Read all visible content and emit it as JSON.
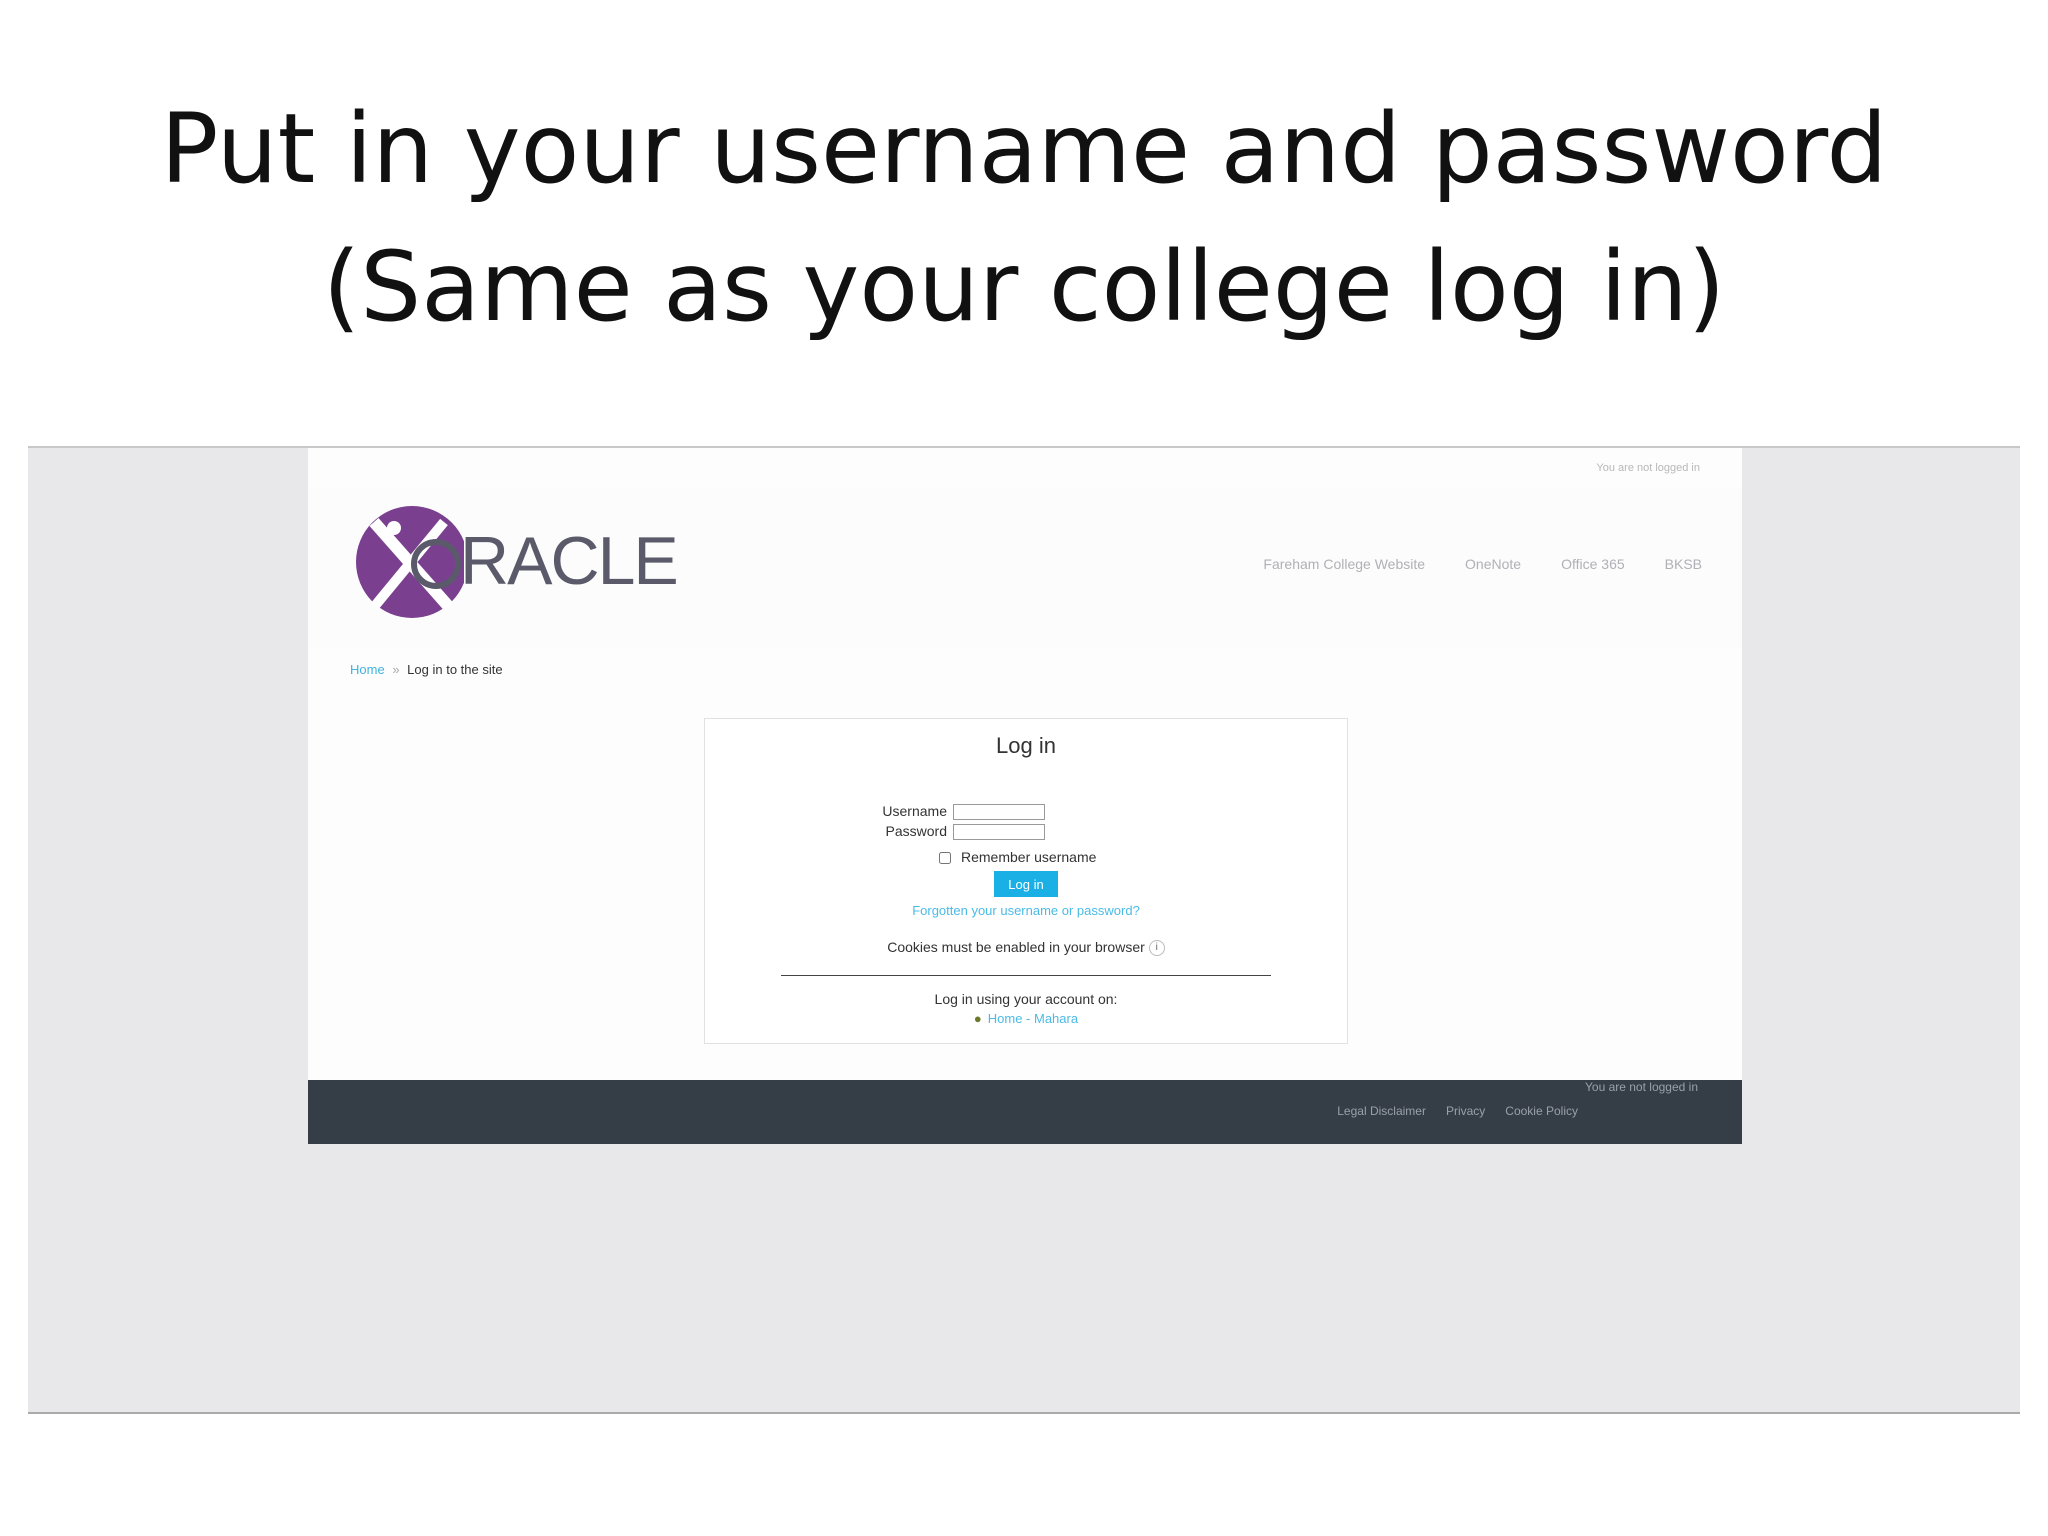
{
  "slide": {
    "title_line1": "Put in your username and password",
    "title_line2": "(Same as your college log in)"
  },
  "site": {
    "not_logged_in_top": "You are not logged in",
    "logo_text": "RACLE",
    "nav": [
      "Fareham College Website",
      "OneNote",
      "Office 365",
      "BKSB"
    ],
    "breadcrumb": {
      "home": "Home",
      "separator": "»",
      "current": "Log in to the site"
    }
  },
  "login": {
    "title": "Log in",
    "username_label": "Username",
    "username_value": "",
    "password_label": "Password",
    "password_value": "",
    "remember_label": "Remember username",
    "remember_checked": false,
    "button_label": "Log in",
    "forgot_link": "Forgotten your username or password?",
    "cookies_text": "Cookies must be enabled in your browser",
    "info_icon": "i",
    "alt_login_text": "Log in using your account on:",
    "mahara_link": "Home - Mahara"
  },
  "footer": {
    "not_logged_in": "You are not logged in",
    "links": [
      "Legal Disclaimer",
      "Privacy",
      "Cookie Policy"
    ]
  },
  "colors": {
    "accent": "#1ab0e6",
    "link": "#4bbbe6",
    "logo_purple": "#7a3f8f",
    "footer_bg": "#353d46"
  }
}
